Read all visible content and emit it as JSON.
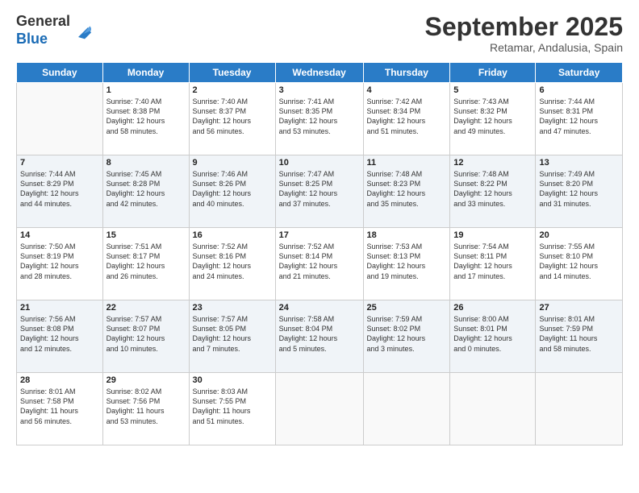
{
  "logo": {
    "general": "General",
    "blue": "Blue"
  },
  "title": "September 2025",
  "subtitle": "Retamar, Andalusia, Spain",
  "weekdays": [
    "Sunday",
    "Monday",
    "Tuesday",
    "Wednesday",
    "Thursday",
    "Friday",
    "Saturday"
  ],
  "rows": [
    [
      {
        "day": "",
        "info": ""
      },
      {
        "day": "1",
        "info": "Sunrise: 7:40 AM\nSunset: 8:38 PM\nDaylight: 12 hours\nand 58 minutes."
      },
      {
        "day": "2",
        "info": "Sunrise: 7:40 AM\nSunset: 8:37 PM\nDaylight: 12 hours\nand 56 minutes."
      },
      {
        "day": "3",
        "info": "Sunrise: 7:41 AM\nSunset: 8:35 PM\nDaylight: 12 hours\nand 53 minutes."
      },
      {
        "day": "4",
        "info": "Sunrise: 7:42 AM\nSunset: 8:34 PM\nDaylight: 12 hours\nand 51 minutes."
      },
      {
        "day": "5",
        "info": "Sunrise: 7:43 AM\nSunset: 8:32 PM\nDaylight: 12 hours\nand 49 minutes."
      },
      {
        "day": "6",
        "info": "Sunrise: 7:44 AM\nSunset: 8:31 PM\nDaylight: 12 hours\nand 47 minutes."
      }
    ],
    [
      {
        "day": "7",
        "info": "Sunrise: 7:44 AM\nSunset: 8:29 PM\nDaylight: 12 hours\nand 44 minutes."
      },
      {
        "day": "8",
        "info": "Sunrise: 7:45 AM\nSunset: 8:28 PM\nDaylight: 12 hours\nand 42 minutes."
      },
      {
        "day": "9",
        "info": "Sunrise: 7:46 AM\nSunset: 8:26 PM\nDaylight: 12 hours\nand 40 minutes."
      },
      {
        "day": "10",
        "info": "Sunrise: 7:47 AM\nSunset: 8:25 PM\nDaylight: 12 hours\nand 37 minutes."
      },
      {
        "day": "11",
        "info": "Sunrise: 7:48 AM\nSunset: 8:23 PM\nDaylight: 12 hours\nand 35 minutes."
      },
      {
        "day": "12",
        "info": "Sunrise: 7:48 AM\nSunset: 8:22 PM\nDaylight: 12 hours\nand 33 minutes."
      },
      {
        "day": "13",
        "info": "Sunrise: 7:49 AM\nSunset: 8:20 PM\nDaylight: 12 hours\nand 31 minutes."
      }
    ],
    [
      {
        "day": "14",
        "info": "Sunrise: 7:50 AM\nSunset: 8:19 PM\nDaylight: 12 hours\nand 28 minutes."
      },
      {
        "day": "15",
        "info": "Sunrise: 7:51 AM\nSunset: 8:17 PM\nDaylight: 12 hours\nand 26 minutes."
      },
      {
        "day": "16",
        "info": "Sunrise: 7:52 AM\nSunset: 8:16 PM\nDaylight: 12 hours\nand 24 minutes."
      },
      {
        "day": "17",
        "info": "Sunrise: 7:52 AM\nSunset: 8:14 PM\nDaylight: 12 hours\nand 21 minutes."
      },
      {
        "day": "18",
        "info": "Sunrise: 7:53 AM\nSunset: 8:13 PM\nDaylight: 12 hours\nand 19 minutes."
      },
      {
        "day": "19",
        "info": "Sunrise: 7:54 AM\nSunset: 8:11 PM\nDaylight: 12 hours\nand 17 minutes."
      },
      {
        "day": "20",
        "info": "Sunrise: 7:55 AM\nSunset: 8:10 PM\nDaylight: 12 hours\nand 14 minutes."
      }
    ],
    [
      {
        "day": "21",
        "info": "Sunrise: 7:56 AM\nSunset: 8:08 PM\nDaylight: 12 hours\nand 12 minutes."
      },
      {
        "day": "22",
        "info": "Sunrise: 7:57 AM\nSunset: 8:07 PM\nDaylight: 12 hours\nand 10 minutes."
      },
      {
        "day": "23",
        "info": "Sunrise: 7:57 AM\nSunset: 8:05 PM\nDaylight: 12 hours\nand 7 minutes."
      },
      {
        "day": "24",
        "info": "Sunrise: 7:58 AM\nSunset: 8:04 PM\nDaylight: 12 hours\nand 5 minutes."
      },
      {
        "day": "25",
        "info": "Sunrise: 7:59 AM\nSunset: 8:02 PM\nDaylight: 12 hours\nand 3 minutes."
      },
      {
        "day": "26",
        "info": "Sunrise: 8:00 AM\nSunset: 8:01 PM\nDaylight: 12 hours\nand 0 minutes."
      },
      {
        "day": "27",
        "info": "Sunrise: 8:01 AM\nSunset: 7:59 PM\nDaylight: 11 hours\nand 58 minutes."
      }
    ],
    [
      {
        "day": "28",
        "info": "Sunrise: 8:01 AM\nSunset: 7:58 PM\nDaylight: 11 hours\nand 56 minutes."
      },
      {
        "day": "29",
        "info": "Sunrise: 8:02 AM\nSunset: 7:56 PM\nDaylight: 11 hours\nand 53 minutes."
      },
      {
        "day": "30",
        "info": "Sunrise: 8:03 AM\nSunset: 7:55 PM\nDaylight: 11 hours\nand 51 minutes."
      },
      {
        "day": "",
        "info": ""
      },
      {
        "day": "",
        "info": ""
      },
      {
        "day": "",
        "info": ""
      },
      {
        "day": "",
        "info": ""
      }
    ]
  ]
}
